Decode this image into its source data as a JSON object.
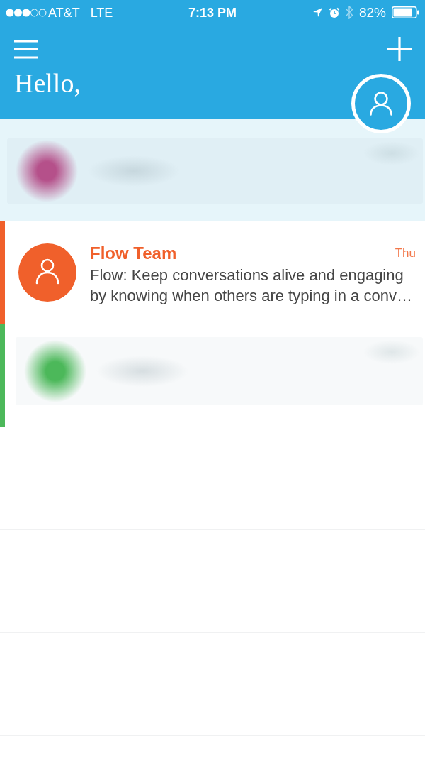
{
  "status_bar": {
    "carrier": "AT&T",
    "network": "LTE",
    "time": "7:13 PM",
    "battery": "82%"
  },
  "header": {
    "greeting": "Hello,"
  },
  "conversations": [
    {
      "kind": "blurred",
      "selected": true,
      "unread": false,
      "color": "#b5508a"
    },
    {
      "kind": "message",
      "selected": false,
      "unread": true,
      "color": "#f0602b",
      "name": "Flow Team",
      "date": "Thu",
      "preview": "Flow: Keep conversations alive and engaging by knowing when others are typing in a conv…"
    },
    {
      "kind": "blurred",
      "selected": false,
      "unread": true,
      "color": "#4cb85a"
    }
  ]
}
